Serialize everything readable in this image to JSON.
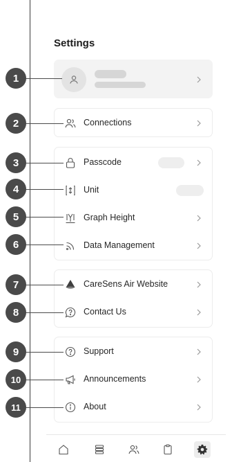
{
  "settings": {
    "title": "Settings"
  },
  "profile": {
    "avatar_icon": "user-icon",
    "chevron_icon": "chevron-right-icon"
  },
  "group_connections": {
    "items": [
      {
        "label": "Connections",
        "icon": "people-icon"
      }
    ]
  },
  "group_preferences": {
    "items": [
      {
        "label": "Passcode",
        "icon": "lock-icon"
      },
      {
        "label": "Unit",
        "icon": "unit-icon"
      },
      {
        "label": "Graph Height",
        "icon": "graph-height-icon"
      },
      {
        "label": "Data Management",
        "icon": "data-management-icon"
      }
    ]
  },
  "group_contact": {
    "items": [
      {
        "label": "CareSens Air Website",
        "icon": "caresens-logo-icon"
      },
      {
        "label": "Contact Us",
        "icon": "chat-question-icon"
      }
    ]
  },
  "group_info": {
    "items": [
      {
        "label": "Support",
        "icon": "help-circle-icon"
      },
      {
        "label": "Announcements",
        "icon": "megaphone-icon"
      },
      {
        "label": "About",
        "icon": "info-icon"
      }
    ]
  },
  "callouts": [
    "1",
    "2",
    "3",
    "4",
    "5",
    "6",
    "7",
    "8",
    "9",
    "10",
    "11"
  ],
  "tabbar": {
    "items": [
      {
        "icon": "home-icon",
        "active": false
      },
      {
        "icon": "list-icon",
        "active": false
      },
      {
        "icon": "people-icon",
        "active": false
      },
      {
        "icon": "clipboard-icon",
        "active": false
      },
      {
        "icon": "gear-icon",
        "active": true
      }
    ]
  },
  "colors": {
    "callout": "#4a4a4a",
    "card_border": "#ececec",
    "profile_bg": "#f3f3f3",
    "placeholder": "#d6d6d6",
    "active_tab_bg": "#ececec"
  }
}
